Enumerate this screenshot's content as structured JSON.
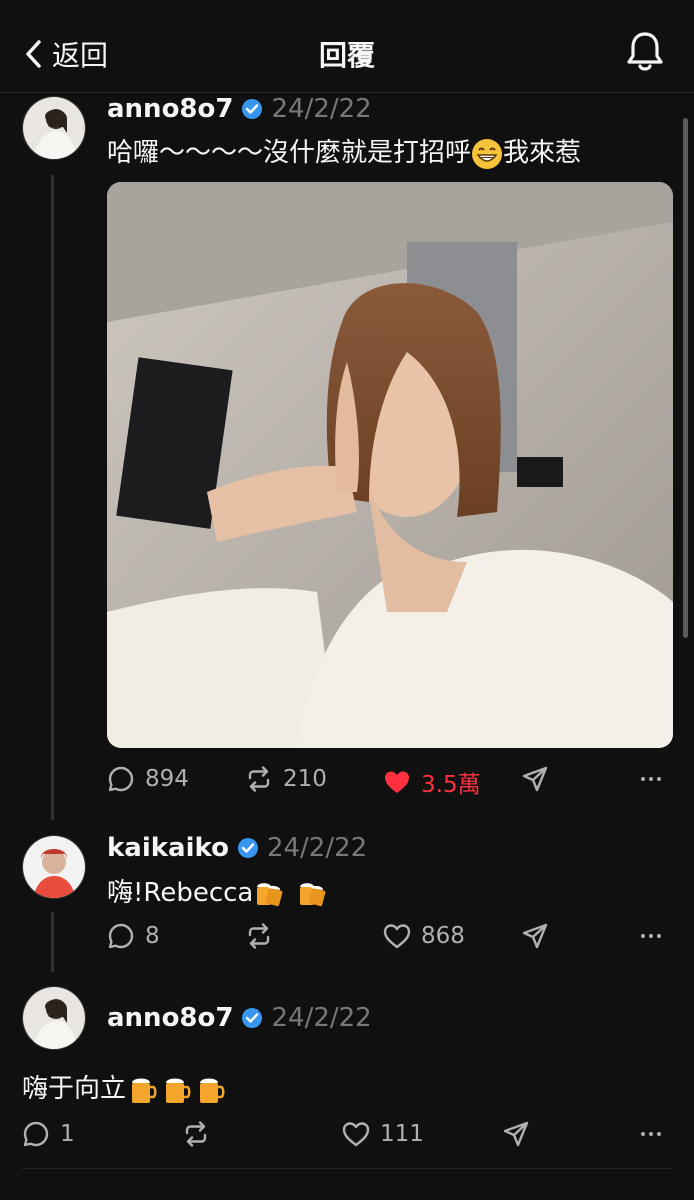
{
  "header": {
    "back_label": "返回",
    "title": "回覆"
  },
  "posts": [
    {
      "username": "anno8o7",
      "date": "24/2/22",
      "text": "哈囉～～～～沒什麼就是打招呼",
      "text_after_emoji": "我來惹",
      "has_image": true,
      "replies": "894",
      "reposts": "210",
      "likes": "3.5萬",
      "liked": true
    },
    {
      "username": "kaikaiko",
      "date": "24/2/22",
      "text": "嗨!Rebecca",
      "replies": "8",
      "reposts": "",
      "likes": "868",
      "liked": false
    },
    {
      "username": "anno8o7",
      "date": "24/2/22",
      "text": "嗨于向立",
      "replies": "1",
      "reposts": "",
      "likes": "111",
      "liked": false
    }
  ],
  "colors": {
    "accent_like": "#ff3040",
    "verified": "#3797f0",
    "background": "#101010"
  },
  "icons": [
    "chevron-left-icon",
    "bell-icon",
    "verified-icon",
    "reply-icon",
    "repost-icon",
    "heart-icon",
    "share-icon",
    "more-icon",
    "beer-icon",
    "grin-emoji"
  ]
}
